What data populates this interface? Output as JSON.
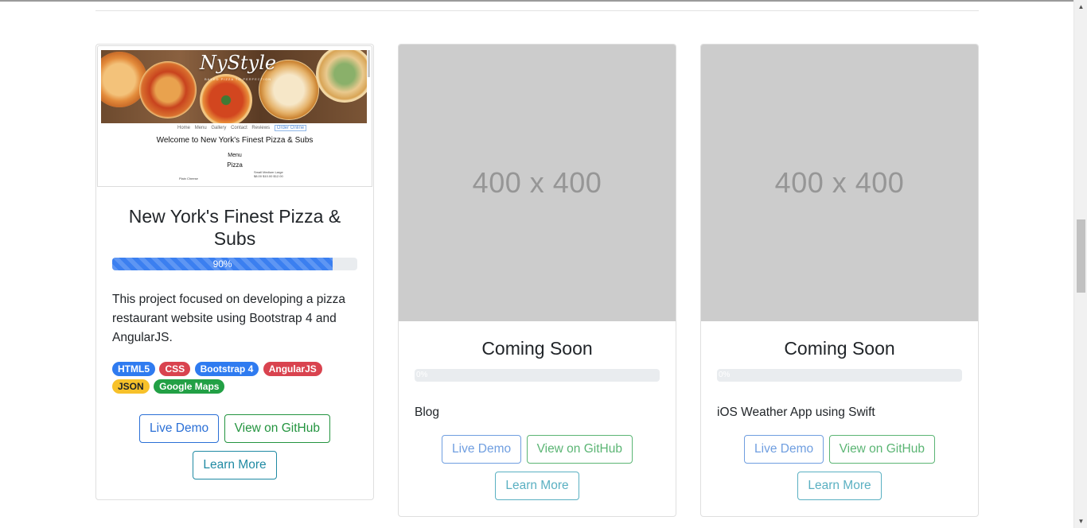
{
  "cards": [
    {
      "title": "New York's Finest Pizza & Subs",
      "progress": 90,
      "progress_label": "90%",
      "description": "This project focused on developing a pizza restaurant website using Bootstrap 4 and AngularJS.",
      "badges": [
        {
          "label": "HTML5",
          "color": "#2f7bf0"
        },
        {
          "label": "CSS",
          "color": "#d9434f"
        },
        {
          "label": "Bootstrap 4",
          "color": "#2f7bf0"
        },
        {
          "label": "AngularJS",
          "color": "#d9434f"
        },
        {
          "label": "JSON",
          "color": "#f7c12a"
        },
        {
          "label": "Google Maps",
          "color": "#22a045"
        }
      ],
      "live_demo": "Live Demo",
      "github": "View on GitHub",
      "learn_more": "Learn More",
      "thumbnail": {
        "logo": "NyStyle",
        "logo_sub": "BAKED PIZZA TO PERFECTION",
        "nav": [
          "Home",
          "Menu",
          "Gallery",
          "Contact",
          "Reviews"
        ],
        "nav_button": "Order Online",
        "welcome": "Welcome to New York's Finest Pizza & Subs",
        "menu": "Menu",
        "section": "Pizza",
        "item": "Plain Cheese",
        "sizes": "Small   Medium Large",
        "prices": "$8.00   $10.00   $12.00"
      }
    },
    {
      "title": "Coming Soon",
      "placeholder": "400 x 400",
      "progress": 0,
      "progress_label": "0%",
      "description": "Blog",
      "live_demo": "Live Demo",
      "github": "View on GitHub",
      "learn_more": "Learn More"
    },
    {
      "title": "Coming Soon",
      "placeholder": "400 x 400",
      "progress": 0,
      "progress_label": "0%",
      "description": "iOS Weather App using Swift",
      "live_demo": "Live Demo",
      "github": "View on GitHub",
      "learn_more": "Learn More"
    }
  ],
  "colors": {
    "primary": "#2a6fd6",
    "success": "#23943f",
    "info": "#1f8aa3",
    "placeholder_bg": "#cccccc",
    "progress_bar": "#3b7ff0"
  }
}
